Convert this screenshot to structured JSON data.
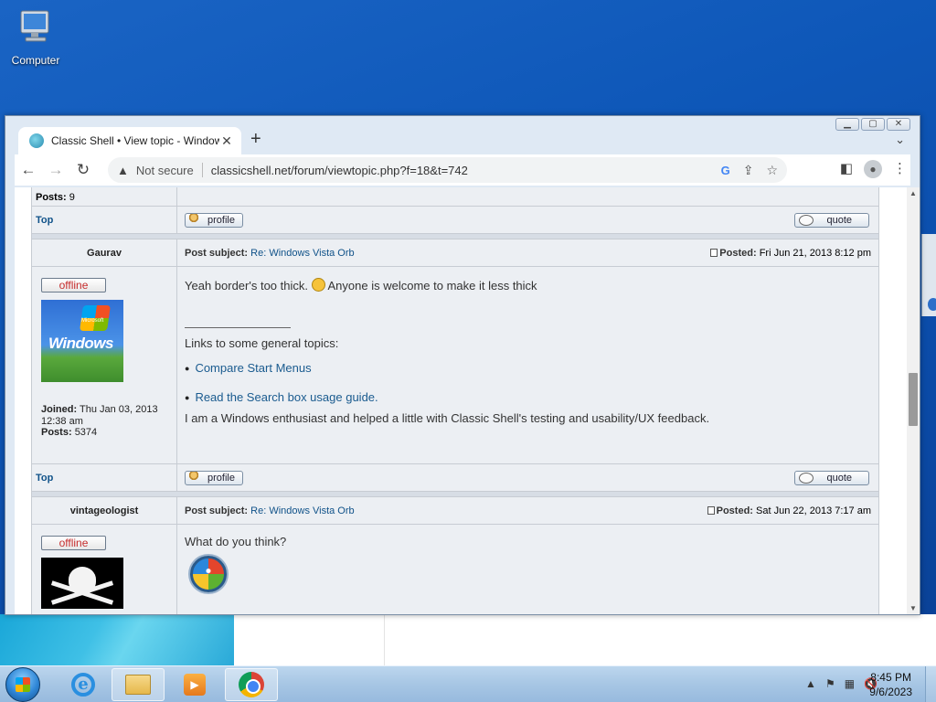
{
  "desktop": {
    "computer_label": "Computer"
  },
  "browser": {
    "tab_title": "Classic Shell • View topic - Windows Vista Orb",
    "security_label": "Not secure",
    "url": "classicshell.net/forum/viewtopic.php?f=18&t=742"
  },
  "forum": {
    "prev_posts_label": "Posts:",
    "prev_posts_value": "9",
    "top_label": "Top",
    "profile_label": "profile",
    "quote_label": "quote",
    "post1": {
      "author": "Gaurav",
      "subject_label": "Post subject:",
      "subject": "Re: Windows Vista Orb",
      "posted_label": "Posted:",
      "posted": "Fri Jun 21, 2013 8:12 pm",
      "status": "offline",
      "joined_label": "Joined:",
      "joined": "Thu Jan 03, 2013 12:38 am",
      "posts_label": "Posts:",
      "posts": "5374",
      "text1": "Yeah border's too thick.",
      "text2": "Anyone is welcome to make it less thick",
      "links_heading": "Links to some general topics:",
      "link1": "Compare Start Menus",
      "link2": "Read the Search box usage guide.",
      "sig": "I am a Windows enthusiast and helped a little with Classic Shell's testing and usability/UX feedback."
    },
    "post2": {
      "author": "vintageologist",
      "subject_label": "Post subject:",
      "subject": "Re: Windows Vista Orb",
      "posted_label": "Posted:",
      "posted": "Sat Jun 22, 2013 7:17 am",
      "status": "offline",
      "text": "What do you think?"
    }
  },
  "taskbar": {
    "time": "8:45 PM",
    "date": "9/6/2023"
  }
}
